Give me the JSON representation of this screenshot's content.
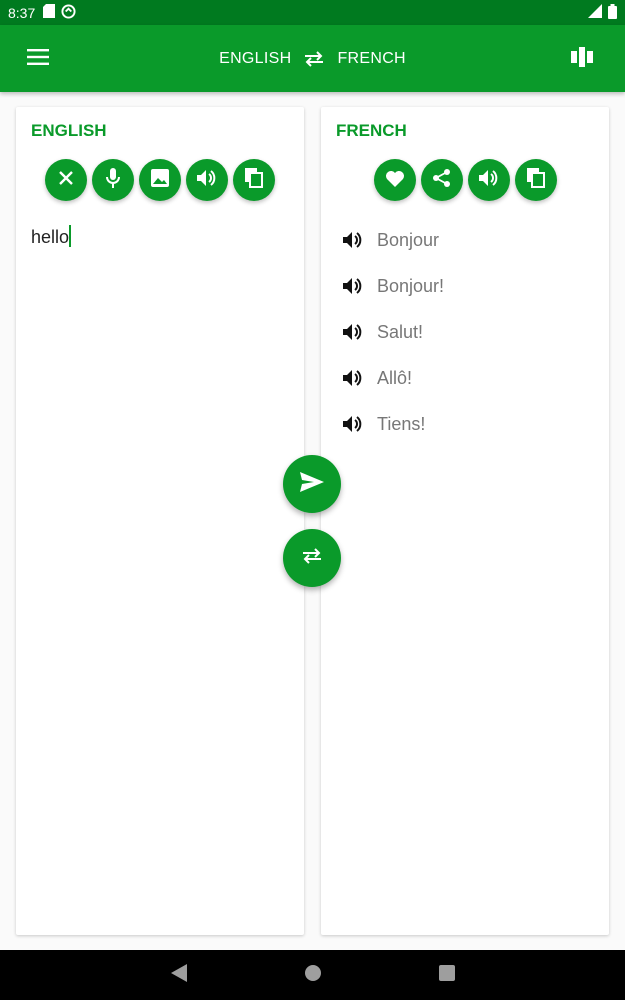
{
  "status_bar": {
    "time": "8:37",
    "icons": [
      "sd-card-icon",
      "sync-icon",
      "signal-icon",
      "battery-icon"
    ]
  },
  "app_bar": {
    "source_language": "ENGLISH",
    "target_language": "FRENCH",
    "icons": [
      "menu-icon",
      "swap-icon",
      "book-icon"
    ]
  },
  "source_panel": {
    "title": "ENGLISH",
    "input_text": "hello",
    "buttons": [
      "clear-icon",
      "mic-icon",
      "image-icon",
      "speaker-icon",
      "copy-icon"
    ]
  },
  "target_panel": {
    "title": "FRENCH",
    "buttons": [
      "heart-icon",
      "share-icon",
      "speaker-icon",
      "copy-icon"
    ],
    "translations": [
      {
        "text": "Bonjour"
      },
      {
        "text": "Bonjour!"
      },
      {
        "text": "Salut!"
      },
      {
        "text": "Allô!"
      },
      {
        "text": "Tiens!"
      }
    ]
  },
  "fabs": [
    "send-icon",
    "swap-icon"
  ],
  "colors": {
    "primary": "#0a9a2a",
    "status_bar": "#007a1f",
    "nav_bar": "#000000"
  }
}
